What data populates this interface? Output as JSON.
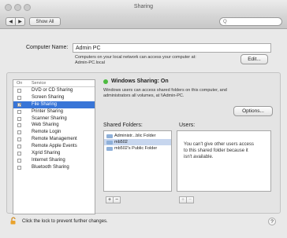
{
  "window": {
    "title": "Sharing"
  },
  "toolbar": {
    "back_label": "◀",
    "forward_label": "▶",
    "show_all_label": "Show All",
    "search_placeholder": "Q"
  },
  "computer_name": {
    "label": "Computer Name:",
    "value": "Admin PC",
    "note_line1": "Computers on your local network can access your computer at:",
    "note_line2": "Admin-PC.local",
    "edit_label": "Edit..."
  },
  "services": {
    "header_on": "On",
    "header_service": "Service",
    "items": [
      {
        "label": "DVD or CD Sharing",
        "checked": false,
        "selected": false
      },
      {
        "label": "Screen Sharing",
        "checked": false,
        "selected": false
      },
      {
        "label": "File Sharing",
        "checked": true,
        "selected": true
      },
      {
        "label": "Printer Sharing",
        "checked": false,
        "selected": false
      },
      {
        "label": "Scanner Sharing",
        "checked": false,
        "selected": false
      },
      {
        "label": "Web Sharing",
        "checked": false,
        "selected": false
      },
      {
        "label": "Remote Login",
        "checked": false,
        "selected": false
      },
      {
        "label": "Remote Management",
        "checked": false,
        "selected": false
      },
      {
        "label": "Remote Apple Events",
        "checked": false,
        "selected": false
      },
      {
        "label": "Xgrid Sharing",
        "checked": false,
        "selected": false
      },
      {
        "label": "Internet Sharing",
        "checked": false,
        "selected": false
      },
      {
        "label": "Bluetooth Sharing",
        "checked": false,
        "selected": false
      }
    ]
  },
  "status": {
    "title": "Windows Sharing: On",
    "color": "#4cbb3f",
    "desc_line1": "Windows users can access shared folders on this computer, and",
    "desc_line2": "administrators all volumes, at \\\\Admin-PC.",
    "options_label": "Options..."
  },
  "shared_folders": {
    "label": "Shared Folders:",
    "items": [
      {
        "label": "Administr...blic Folder",
        "selected": false
      },
      {
        "label": "mb502",
        "selected": true
      },
      {
        "label": "mb502's Public Folder",
        "selected": false
      }
    ],
    "add_label": "+",
    "remove_label": "−"
  },
  "users": {
    "label": "Users:",
    "message_line1": "You can't give other users access",
    "message_line2": "to this shared folder because it",
    "message_line3": "isn't available.",
    "add_label": "+",
    "remove_label": "−"
  },
  "footer": {
    "lock_text": "Click the lock to prevent further changes.",
    "help_label": "?"
  }
}
